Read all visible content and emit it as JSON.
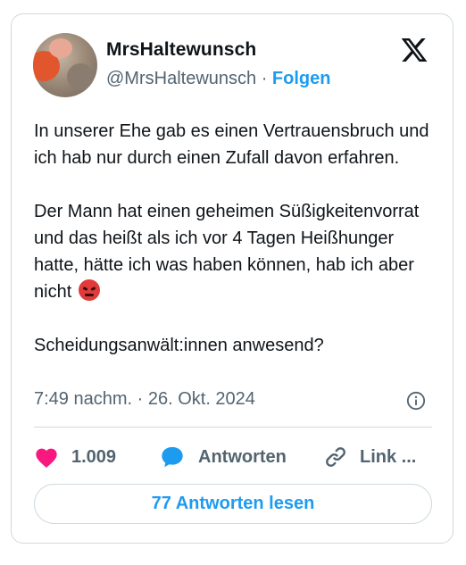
{
  "author": {
    "name": "MrsHaltewunsch",
    "handle": "@MrsHaltewunsch",
    "separator": "·",
    "follow_label": "Folgen"
  },
  "tweet": {
    "paragraphs": [
      "In unserer Ehe gab es einen Vertrauensbruch und ich hab nur durch einen Zufall davon erfahren.",
      "Der Mann hat einen geheimen Süßigkeitenvorrat und das heißt als ich vor 4 Tagen Heißhunger hatte, hätte ich was haben können, hab ich aber nicht",
      "Scheidungsanwält:innen anwesend?"
    ],
    "emoji": "angry-face",
    "timestamp": "7:49 nachm. · 26. Okt. 2024"
  },
  "actions": {
    "like_count": "1.009",
    "reply_label": "Antworten",
    "link_label": "Link ..."
  },
  "read_replies_label": "77 Antworten lesen",
  "colors": {
    "accent": "#1d9bf0",
    "like": "#f91880",
    "muted": "#536471",
    "text": "#0f1419",
    "border": "#cfd9de",
    "emoji": "#e03a3a"
  },
  "icons": [
    "x-logo-icon",
    "info-icon",
    "heart-icon",
    "reply-bubble-icon",
    "link-icon"
  ]
}
